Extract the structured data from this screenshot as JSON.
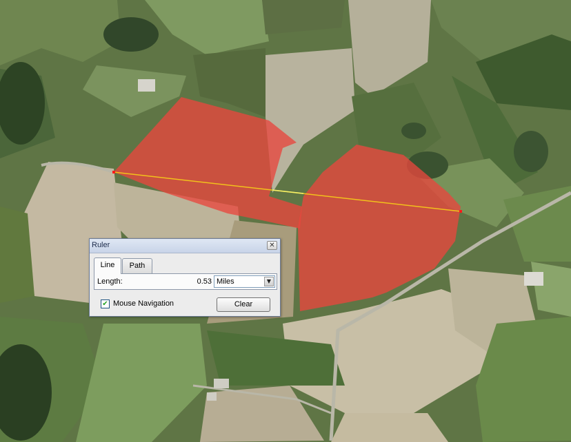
{
  "ruler": {
    "title": "Ruler",
    "close_glyph": "✕",
    "tabs": [
      {
        "label": "Line",
        "active": true
      },
      {
        "label": "Path",
        "active": false
      }
    ],
    "length_label": "Length:",
    "length_value": "0.53",
    "units": {
      "selected": "Miles",
      "arrow_glyph": "▼"
    },
    "mouse_navigation": {
      "label": "Mouse Navigation",
      "checked": true,
      "check_glyph": "✔"
    },
    "clear_label": "Clear"
  },
  "map": {
    "measure_line_color": "#f2c21b",
    "field_overlay_color": "#e8463e",
    "endpoint_color": "#ff1a1a"
  },
  "icons": [
    "close-icon",
    "chevron-down-icon",
    "check-icon"
  ]
}
